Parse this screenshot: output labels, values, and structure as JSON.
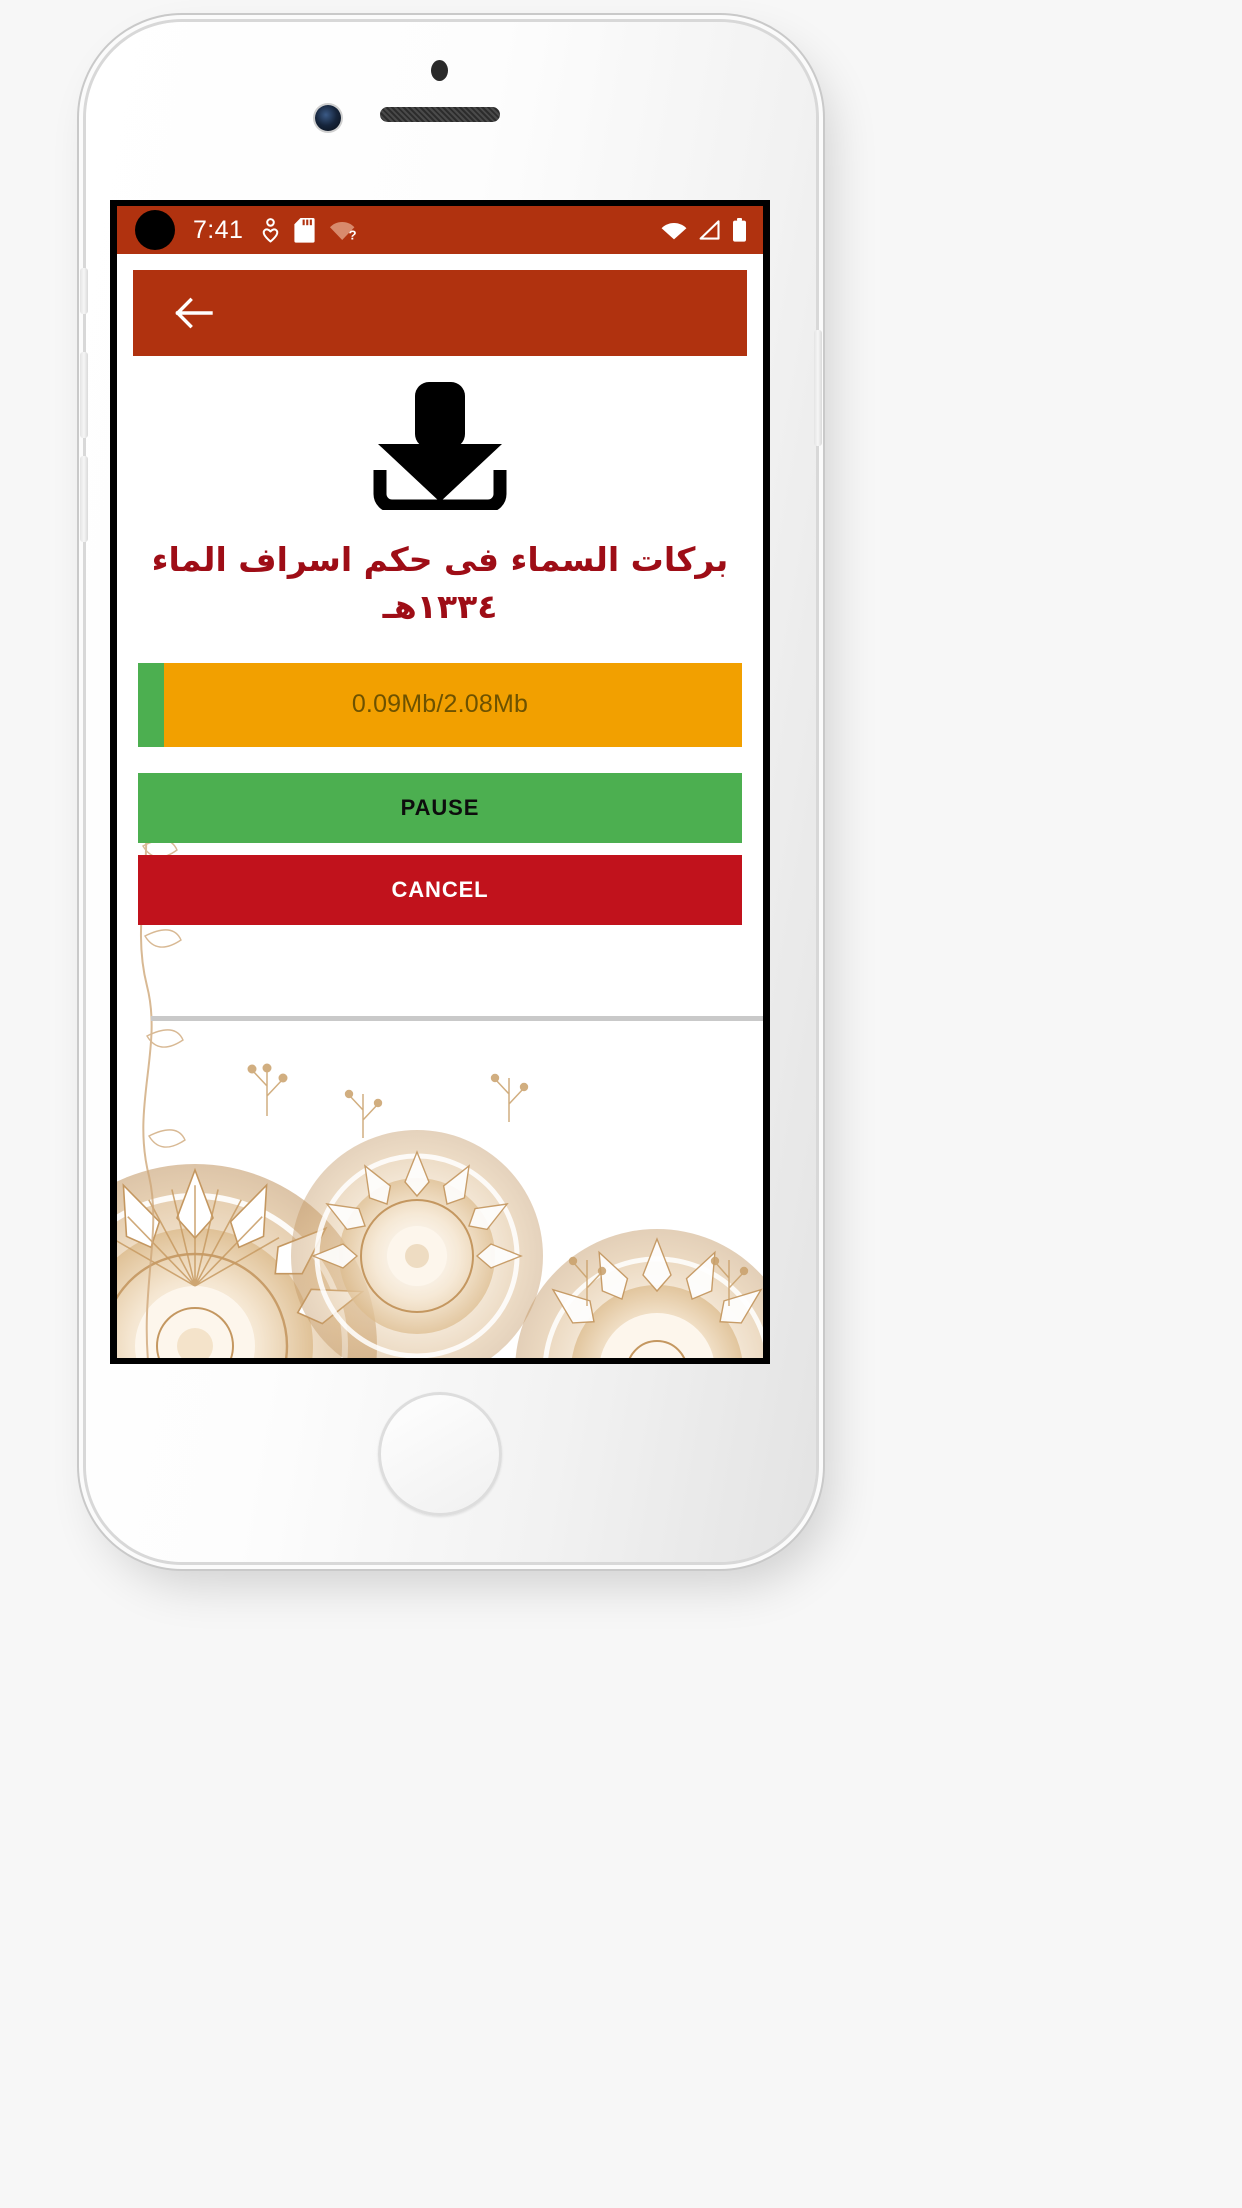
{
  "device": {
    "frame": "iphone-white-silver",
    "hardware": {
      "camera_icon": "front-camera-icon",
      "earpiece_icon": "earpiece-speaker-icon",
      "sensor_icon": "proximity-sensor-icon",
      "home_button": "home-button"
    }
  },
  "status_bar": {
    "clock": "7:41",
    "background_color": "#b0320f",
    "foreground_color": "#ffffff",
    "left_icons": [
      {
        "name": "location-heart-icon",
        "label": "location"
      },
      {
        "name": "sd-card-icon",
        "label": "sd card"
      },
      {
        "name": "wifi-unknown-icon",
        "label": "wifi unknown"
      }
    ],
    "right_icons": [
      {
        "name": "wifi-icon",
        "label": "wifi"
      },
      {
        "name": "signal-icon",
        "label": "cellular signal"
      },
      {
        "name": "battery-icon",
        "label": "battery full"
      }
    ],
    "punch_hole": "camera-punch-hole"
  },
  "app_bar": {
    "background_color": "#b0320f",
    "back_icon": "back-arrow-icon",
    "title": ""
  },
  "download_screen": {
    "icon": "download-icon",
    "book_title": "بركات السماء فى حكم اسراف الماء",
    "book_year": "١٣٣٤هـ",
    "title_color": "#9e0d16",
    "progress": {
      "label": "0.09Mb/2.08Mb",
      "downloaded_mb": 0.09,
      "total_mb": 2.08,
      "percent": 4.3,
      "track_color": "#f2a000",
      "fill_color": "#4caf50",
      "label_color": "#6d5200"
    },
    "pause_button": {
      "label": "PAUSE",
      "background_color": "#4caf50",
      "text_color": "#0d0d0d"
    },
    "cancel_button": {
      "label": "CANCEL",
      "background_color": "#c1121c",
      "text_color": "#ffffff"
    },
    "ornament": {
      "name": "gold-mandala-ornament",
      "primary_color": "#c9a06a",
      "light_color": "#e7cfa8"
    }
  },
  "nav_bar": {
    "pill": "home-gesture-pill",
    "background_color": "#000000"
  }
}
